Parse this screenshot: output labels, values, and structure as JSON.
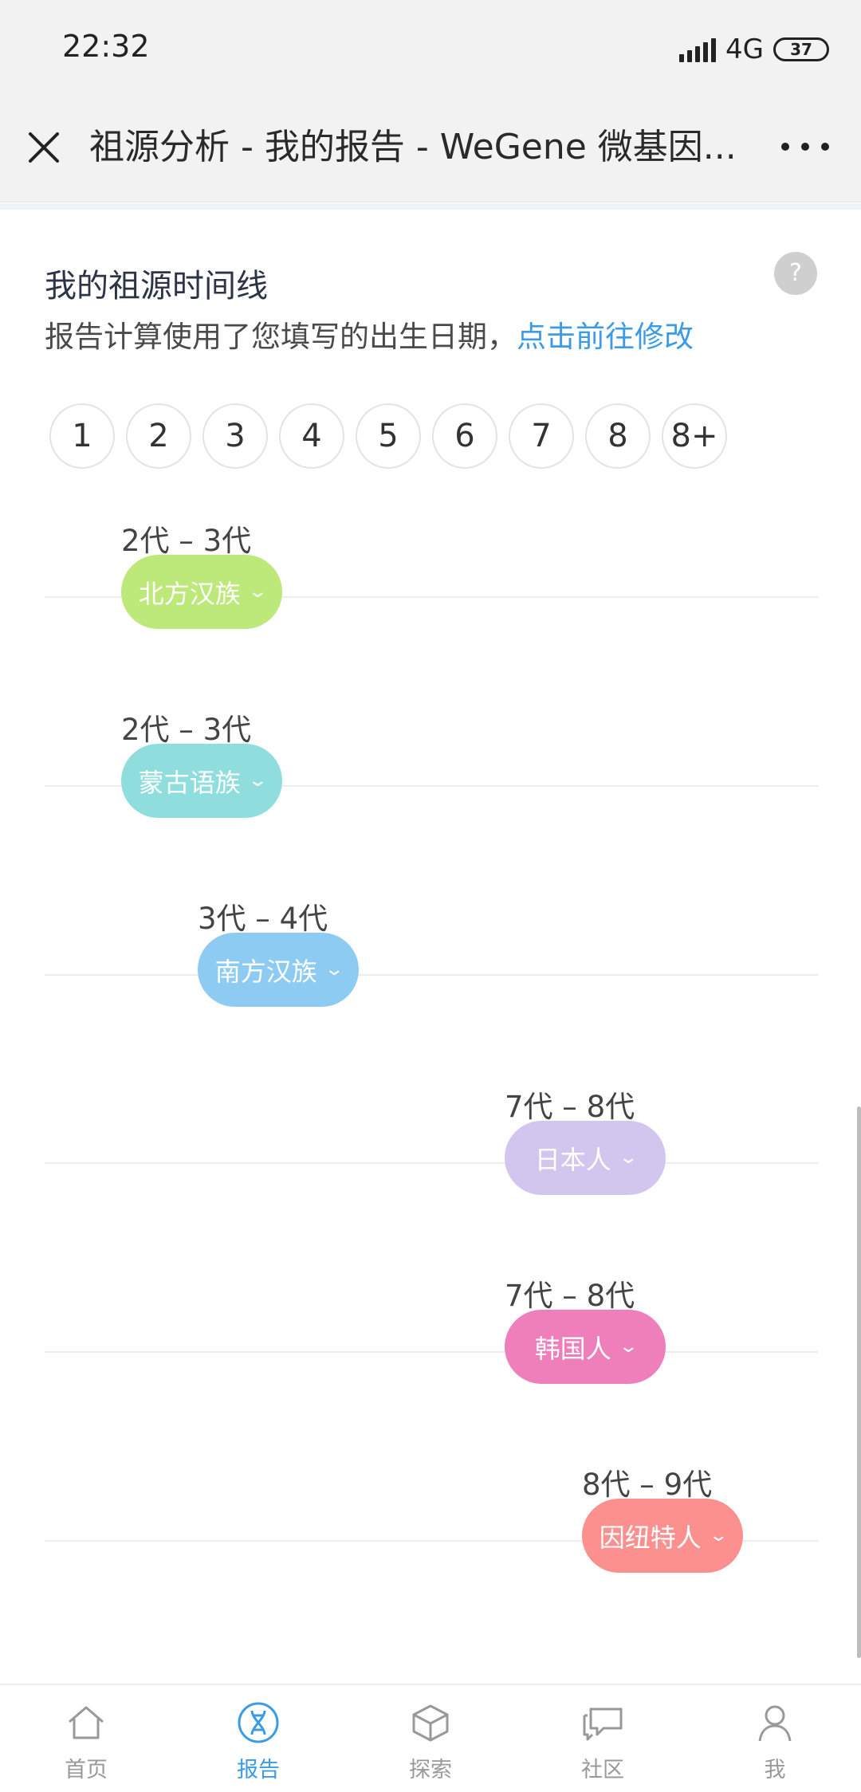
{
  "status_bar": {
    "time": "22:32",
    "network": "4G",
    "battery": "37"
  },
  "title_bar": {
    "title": "祖源分析 - 我的报告 - WeGene 微基因..."
  },
  "section": {
    "title": "我的祖源时间线",
    "subtitle_text": "报告计算使用了您填写的出生日期，",
    "subtitle_link": "点击前往修改",
    "help": "?"
  },
  "generations": [
    "1",
    "2",
    "3",
    "4",
    "5",
    "6",
    "7",
    "8",
    "8+"
  ],
  "timeline": [
    {
      "range": "2代 – 3代",
      "label": "北方汉族",
      "color": "#bde87a"
    },
    {
      "range": "2代 – 3代",
      "label": "蒙古语族",
      "color": "#8fdedd"
    },
    {
      "range": "3代 – 4代",
      "label": "南方汉族",
      "color": "#8ecbf2"
    },
    {
      "range": "7代 – 8代",
      "label": "日本人",
      "color": "#d2c6ef"
    },
    {
      "range": "7代 – 8代",
      "label": "韩国人",
      "color": "#ee7fba"
    },
    {
      "range": "8代 – 9代",
      "label": "因纽特人",
      "color": "#fb908f"
    }
  ],
  "nav": [
    {
      "label": "首页",
      "icon": "home-icon"
    },
    {
      "label": "报告",
      "icon": "dna-icon"
    },
    {
      "label": "探索",
      "icon": "cube-icon"
    },
    {
      "label": "社区",
      "icon": "chat-icon"
    },
    {
      "label": "我",
      "icon": "user-icon"
    }
  ],
  "colors": {
    "accent": "#3b9be6"
  }
}
